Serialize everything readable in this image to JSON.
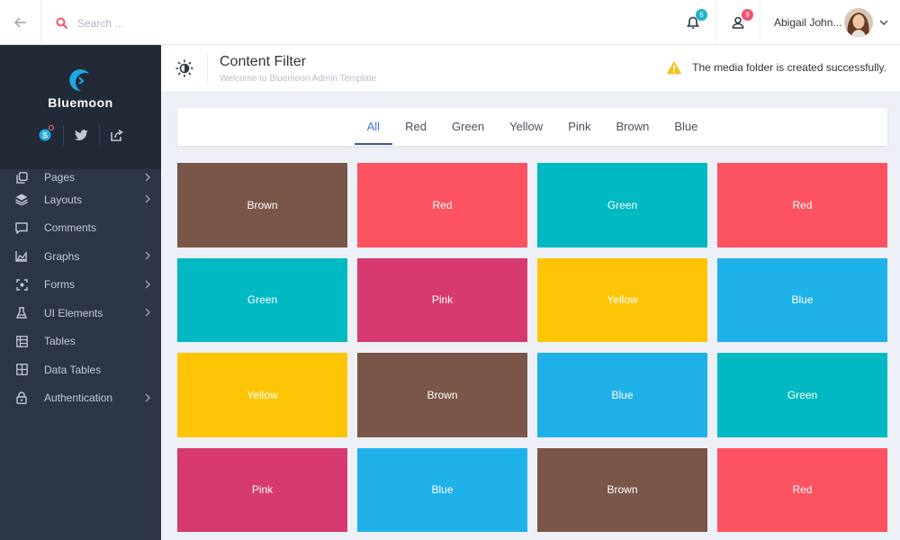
{
  "topbar": {
    "search_placeholder": "Search ...",
    "notifications_count": "6",
    "users_count": "9",
    "profile_name": "Abigail John..."
  },
  "sidebar": {
    "brand": "Bluemoon",
    "menu": [
      {
        "label": "Pages",
        "icon": "pages-icon",
        "has_arrow": true
      },
      {
        "label": "Layouts",
        "icon": "layers-icon",
        "has_arrow": true
      },
      {
        "label": "Comments",
        "icon": "comment-icon",
        "has_arrow": false
      },
      {
        "label": "Graphs",
        "icon": "area-chart-icon",
        "has_arrow": true
      },
      {
        "label": "Forms",
        "icon": "forms-icon",
        "has_arrow": true
      },
      {
        "label": "UI Elements",
        "icon": "flask-icon",
        "has_arrow": true
      },
      {
        "label": "Tables",
        "icon": "table-icon",
        "has_arrow": false
      },
      {
        "label": "Data Tables",
        "icon": "grid-icon",
        "has_arrow": false
      },
      {
        "label": "Authentication",
        "icon": "lock-icon",
        "has_arrow": true
      }
    ]
  },
  "header": {
    "title": "Content Filter",
    "subtitle": "Welcome to Bluemoon Admin Template",
    "alert_text": "The media folder is created successfully."
  },
  "filters": [
    "All",
    "Red",
    "Green",
    "Yellow",
    "Pink",
    "Brown",
    "Blue"
  ],
  "active_filter": "All",
  "colors": {
    "Brown": "#7a5648",
    "Red": "#fd5260",
    "Green": "#00b9c2",
    "Pink": "#d63a6f",
    "Yellow": "#fec506",
    "Blue": "#1fb1ea",
    "accent": "#3b7bd5",
    "badge_teal": "#1cb3c8",
    "badge_red": "#f4516c",
    "warning": "#f7c11e"
  },
  "tiles": [
    "Brown",
    "Red",
    "Green",
    "Red",
    "Green",
    "Pink",
    "Yellow",
    "Blue",
    "Yellow",
    "Brown",
    "Blue",
    "Green",
    "Pink",
    "Blue",
    "Brown",
    "Red"
  ]
}
